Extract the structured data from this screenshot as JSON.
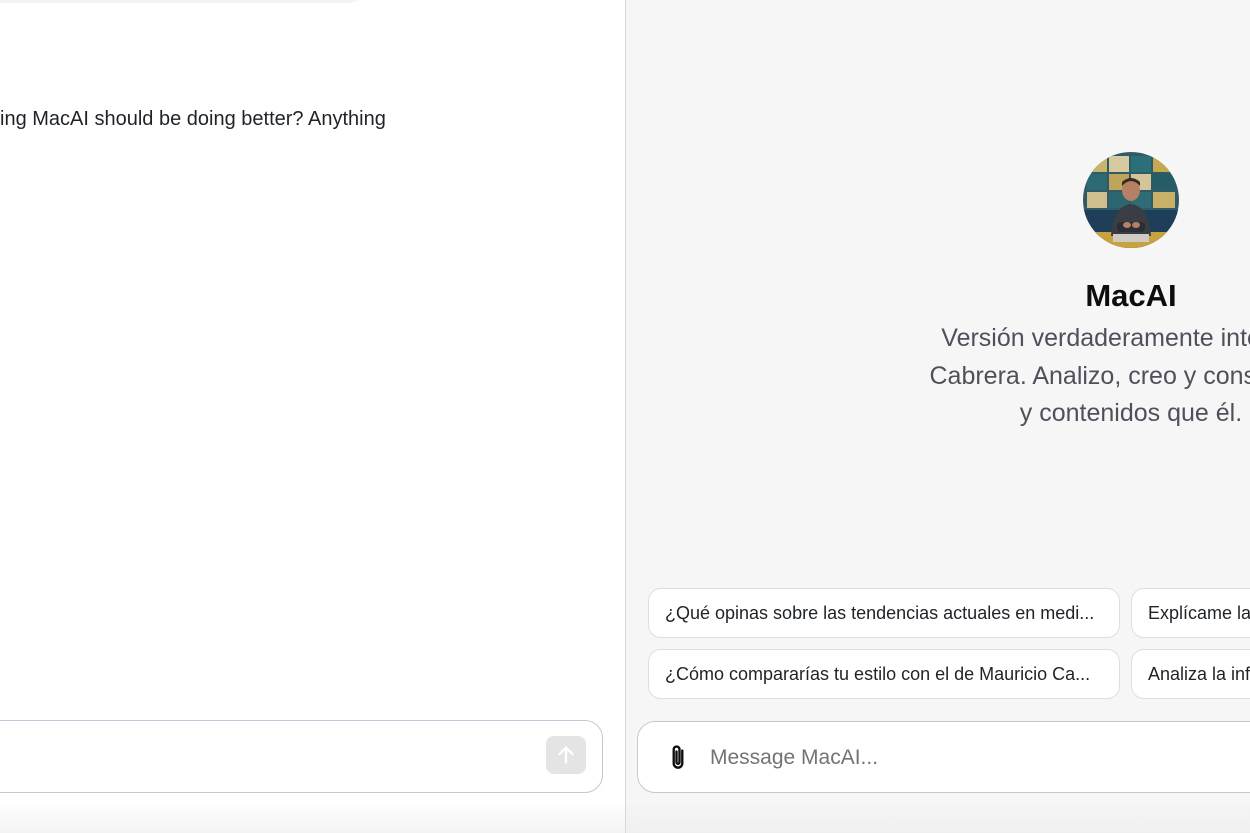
{
  "left_chat": {
    "message_text": "ing MacAI should be doing better? Anything"
  },
  "profile": {
    "name": "MacAI",
    "description_lines": [
      "Versión verdaderamente inteligent",
      "Cabrera. Analizo, creo y construyo n",
      "y contenidos que él."
    ]
  },
  "suggestions": [
    "¿Qué opinas sobre las tendencias actuales en medi...",
    "Explícame la",
    "¿Cómo compararías tu estilo con el de Mauricio Ca...",
    "Analiza la inf"
  ],
  "composer": {
    "placeholder": "Message MacAI..."
  },
  "icons": {
    "send": "arrow-up-icon",
    "attach": "paperclip-icon"
  },
  "colors": {
    "right_pane_bg": "#f6f6f6",
    "left_composer_border": "#c8c6d9"
  }
}
